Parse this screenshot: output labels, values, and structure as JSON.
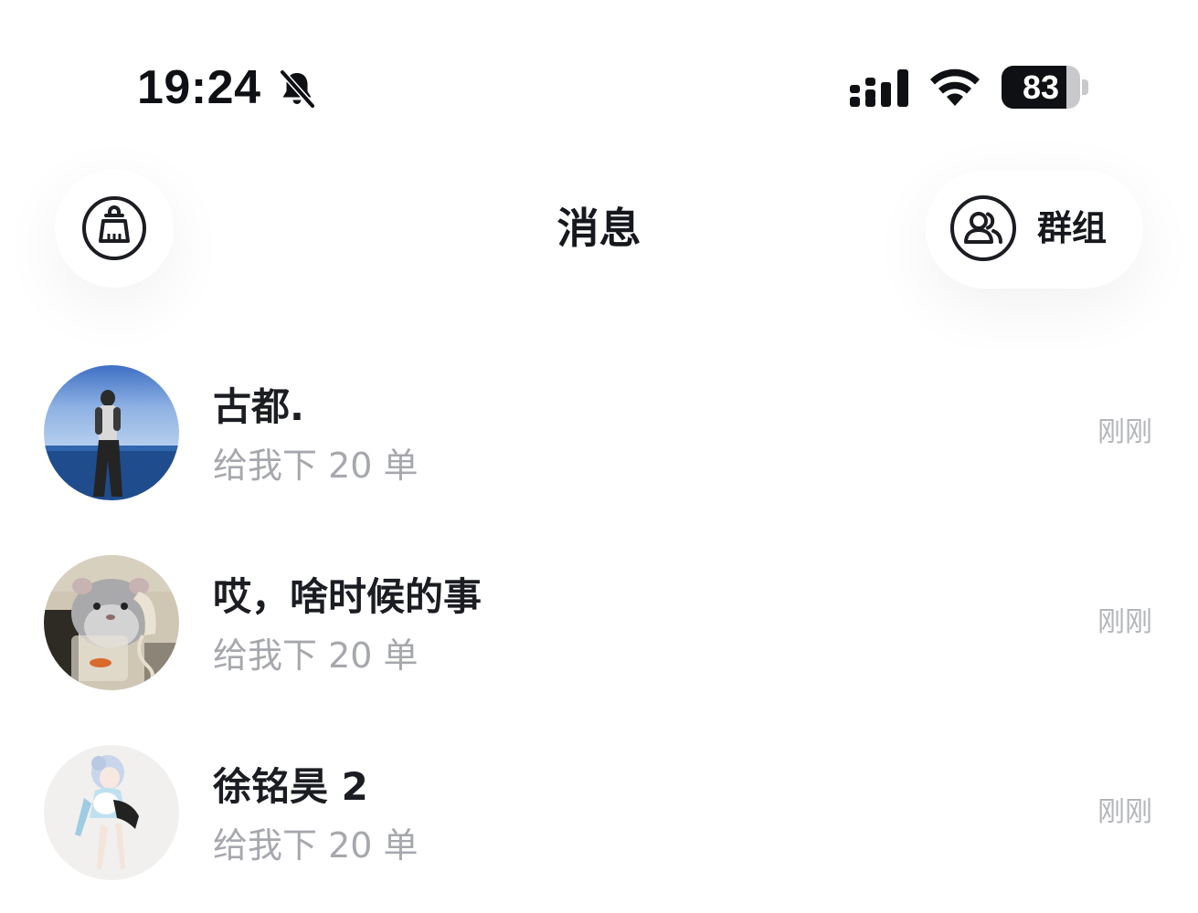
{
  "status_bar": {
    "time": "19:24",
    "mute_icon": "bell-slash-icon",
    "signal_icon": "cellular-signal-icon",
    "wifi_icon": "wifi-icon",
    "battery_level": 83,
    "battery_text": "83"
  },
  "header": {
    "title": "消息",
    "left_icon": "clean-broom-icon",
    "group_icon": "people-icon",
    "group_label": "群组"
  },
  "messages": [
    {
      "name": "古都.",
      "preview": "给我下 20 单",
      "time": "刚刚",
      "avatar": "photo-person-by-sea"
    },
    {
      "name": "哎，啥时候的事",
      "preview": "给我下 20 单",
      "time": "刚刚",
      "avatar": "photo-hamster-with-phone"
    },
    {
      "name": "徐铭昊 2",
      "preview": "给我下 20 单",
      "time": "刚刚",
      "avatar": "illustration-anime-girl"
    }
  ],
  "colors": {
    "primary_text": "#1b1d22",
    "secondary_text": "#a6a8ad",
    "time_text": "#b3b5ba",
    "background": "#ffffff"
  }
}
